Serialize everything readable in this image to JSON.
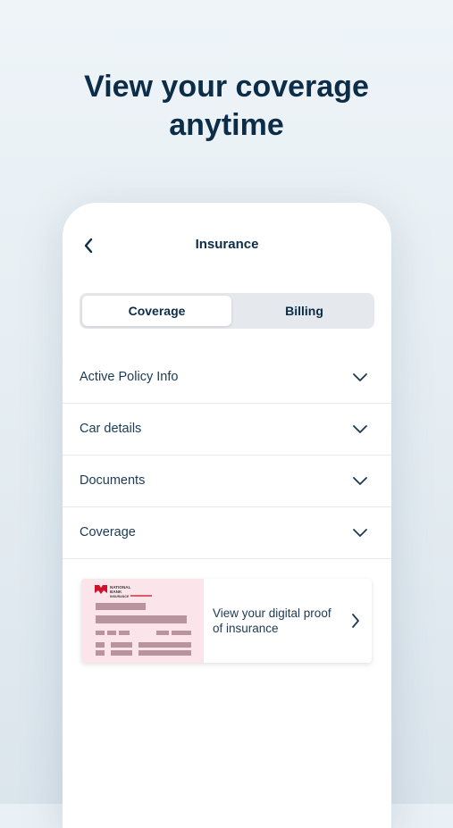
{
  "headline": {
    "line1": "View your coverage",
    "line2": "anytime"
  },
  "app": {
    "title": "Insurance",
    "back_icon": "chevron-left-icon"
  },
  "tabs": [
    {
      "label": "Coverage",
      "selected": true
    },
    {
      "label": "Billing",
      "selected": false
    }
  ],
  "accordion": [
    {
      "label": "Active Policy Info",
      "icon": "chevron-down-icon"
    },
    {
      "label": "Car details",
      "icon": "chevron-down-icon"
    },
    {
      "label": "Documents",
      "icon": "chevron-down-icon"
    },
    {
      "label": "Coverage",
      "icon": "chevron-down-icon"
    }
  ],
  "proof_card": {
    "text": "View your digital proof of insurance",
    "thumbnail_logo_lines": [
      "NATIONAL",
      "BANK",
      "INSURANCE"
    ],
    "arrow_icon": "chevron-right-icon"
  },
  "colors": {
    "text_primary": "#0c2d48",
    "brand_red": "#d0112b",
    "card_pink": "#fbe4ea"
  }
}
